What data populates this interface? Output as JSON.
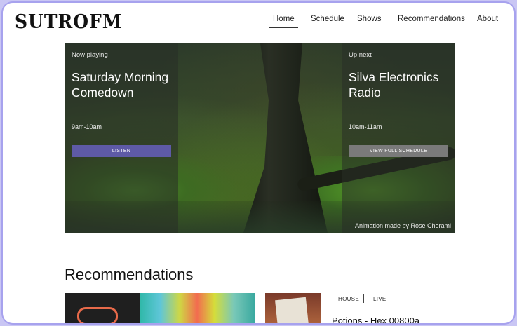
{
  "brand": {
    "logo_text": "SUTROFM"
  },
  "nav": {
    "items": [
      {
        "label": "Home",
        "active": true
      },
      {
        "label": "Schedule",
        "active": false
      },
      {
        "label": "Shows",
        "active": false
      },
      {
        "label": "Recommendations",
        "active": false
      },
      {
        "label": "About",
        "active": false
      }
    ]
  },
  "hero": {
    "now_playing": {
      "label": "Now playing",
      "title": "Saturday Morning Comedown",
      "time": "9am-10am",
      "button": "LISTEN"
    },
    "up_next": {
      "label": "Up next",
      "title": "Silva Electronics Radio",
      "time": "10am-11am",
      "button": "VIEW FULL SCHEDULE"
    },
    "credit": "Animation made by Rose Cherami"
  },
  "recommendations": {
    "heading": "Recommendations",
    "tags": [
      "HOUSE",
      "LIVE"
    ],
    "featured_title": "Potions - Hex 00800a"
  },
  "colors": {
    "accent_button": "#5e5aa6",
    "secondary_button": "#7a7a7a",
    "frame_border": "#a7a2ee"
  }
}
